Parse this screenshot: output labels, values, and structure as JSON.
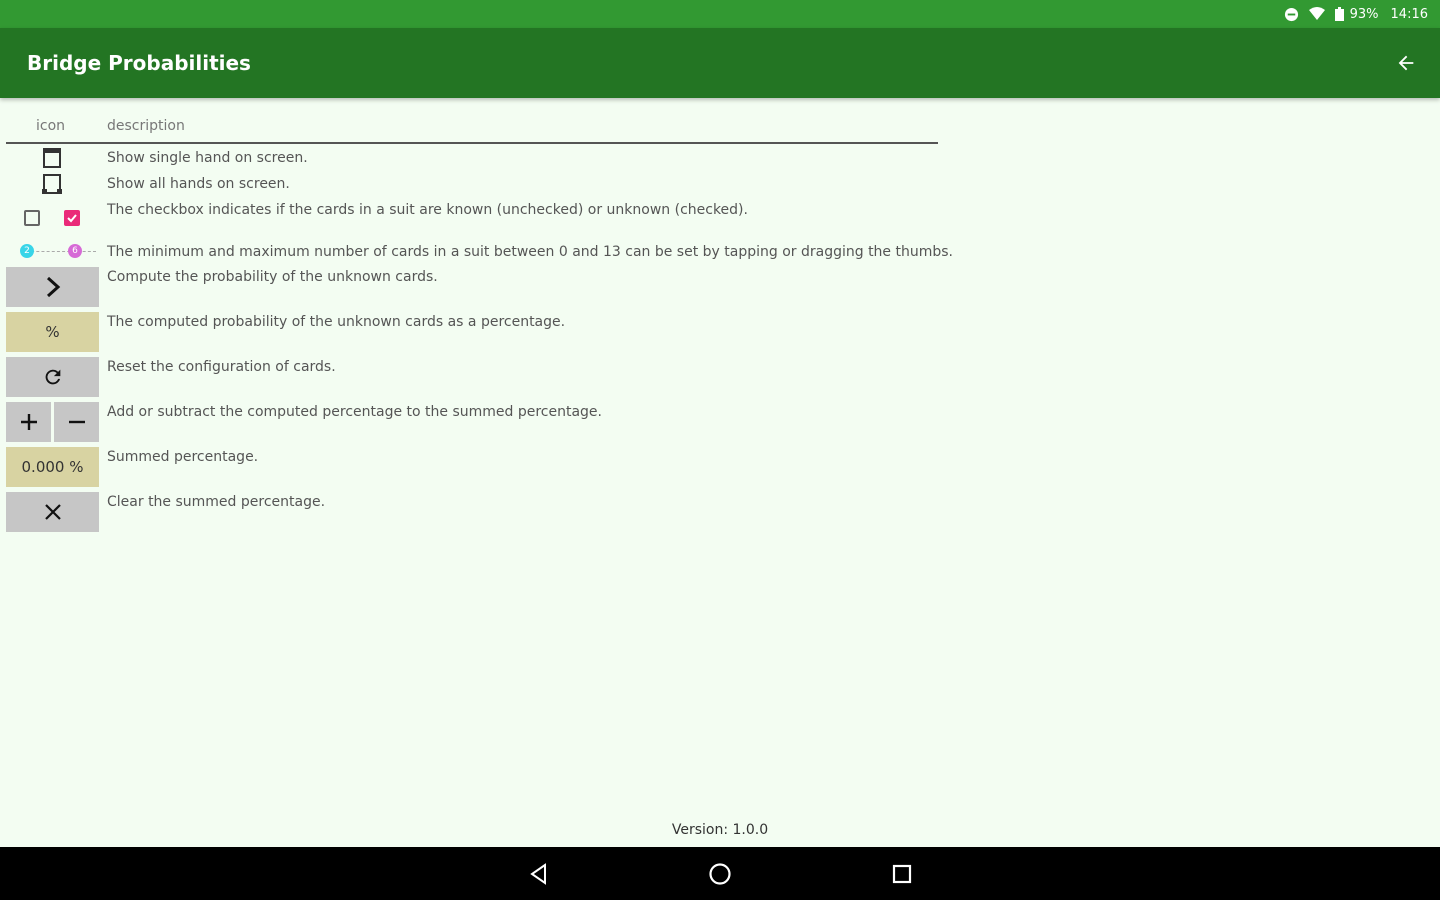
{
  "status_bar": {
    "battery": "93%",
    "time": "14:16"
  },
  "app_bar": {
    "title": "Bridge Probabilities",
    "back_icon": "arrow-left-icon"
  },
  "table": {
    "headers": {
      "icon": "icon",
      "description": "description"
    },
    "rows": [
      {
        "icon": "single-hand-icon",
        "description": "Show single hand on screen."
      },
      {
        "icon": "all-hands-icon",
        "description": "Show all hands on screen."
      },
      {
        "icon": "checkbox-icon",
        "description": "The checkbox indicates if the cards in a suit are known (unchecked) or unknown (checked)."
      },
      {
        "icon": "range-slider-icon",
        "description": "The minimum and maximum number of cards in a suit between 0 and 13 can be set by tapping or dragging the thumbs.",
        "slider_min": "2",
        "slider_max": "6"
      },
      {
        "icon": "chevron-right-icon",
        "description": "Compute the probability of the unknown cards."
      },
      {
        "icon": "percent-icon",
        "description": "The computed probability of the unknown cards as a percentage.",
        "label": "%"
      },
      {
        "icon": "refresh-icon",
        "description": "Reset the configuration of cards."
      },
      {
        "icon": "plus-minus-icon",
        "description": "Add or subtract the computed percentage to the summed percentage."
      },
      {
        "icon": "summed-percentage-icon",
        "description": "Summed percentage.",
        "label": "0.000 %"
      },
      {
        "icon": "close-icon",
        "description": "Clear the summed percentage."
      }
    ]
  },
  "footer": {
    "version": "Version: 1.0.0"
  },
  "nav_bar": {
    "back": "nav-back-icon",
    "home": "nav-home-icon",
    "recents": "nav-recents-icon"
  },
  "colors": {
    "status_bar": "#329932",
    "app_bar": "#237523",
    "background": "#f3fdf2",
    "button_gray": "#c6c6c6",
    "button_tan": "#d8d3a2",
    "checkbox_checked": "#ea2a79"
  }
}
